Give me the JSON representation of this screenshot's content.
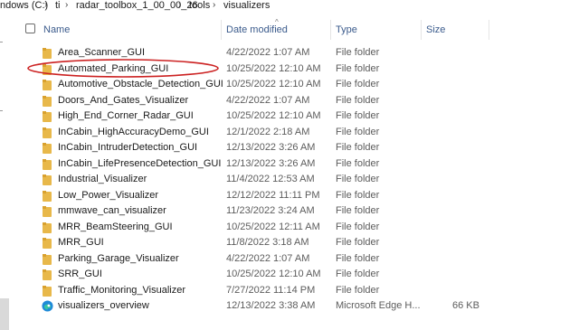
{
  "breadcrumb": {
    "segments": [
      "ndows (C:)",
      "ti",
      "radar_toolbox_1_00_00_26",
      "tools",
      "visualizers"
    ],
    "separator": "›"
  },
  "columns": {
    "name": "Name",
    "date": "Date modified",
    "type": "Type",
    "size": "Size"
  },
  "files": [
    {
      "name": "Area_Scanner_GUI",
      "date": "4/22/2022 1:07 AM",
      "type": "File folder",
      "size": "",
      "icon": "folder-icon"
    },
    {
      "name": "Automated_Parking_GUI",
      "date": "10/25/2022 12:10 AM",
      "type": "File folder",
      "size": "",
      "icon": "folder-icon"
    },
    {
      "name": "Automotive_Obstacle_Detection_GUI",
      "date": "10/25/2022 12:10 AM",
      "type": "File folder",
      "size": "",
      "icon": "folder-icon"
    },
    {
      "name": "Doors_And_Gates_Visualizer",
      "date": "4/22/2022 1:07 AM",
      "type": "File folder",
      "size": "",
      "icon": "folder-icon"
    },
    {
      "name": "High_End_Corner_Radar_GUI",
      "date": "10/25/2022 12:10 AM",
      "type": "File folder",
      "size": "",
      "icon": "folder-icon"
    },
    {
      "name": "InCabin_HighAccuracyDemo_GUI",
      "date": "12/1/2022 2:18 AM",
      "type": "File folder",
      "size": "",
      "icon": "folder-icon"
    },
    {
      "name": "InCabin_IntruderDetection_GUI",
      "date": "12/13/2022 3:26 AM",
      "type": "File folder",
      "size": "",
      "icon": "folder-icon"
    },
    {
      "name": "InCabin_LifePresenceDetection_GUI",
      "date": "12/13/2022 3:26 AM",
      "type": "File folder",
      "size": "",
      "icon": "folder-icon"
    },
    {
      "name": "Industrial_Visualizer",
      "date": "11/4/2022 12:53 AM",
      "type": "File folder",
      "size": "",
      "icon": "folder-icon"
    },
    {
      "name": "Low_Power_Visualizer",
      "date": "12/12/2022 11:11 PM",
      "type": "File folder",
      "size": "",
      "icon": "folder-icon"
    },
    {
      "name": "mmwave_can_visualizer",
      "date": "11/23/2022 3:24 AM",
      "type": "File folder",
      "size": "",
      "icon": "folder-icon"
    },
    {
      "name": "MRR_BeamSteering_GUI",
      "date": "10/25/2022 12:11 AM",
      "type": "File folder",
      "size": "",
      "icon": "folder-icon"
    },
    {
      "name": "MRR_GUI",
      "date": "11/8/2022 3:18 AM",
      "type": "File folder",
      "size": "",
      "icon": "folder-icon"
    },
    {
      "name": "Parking_Garage_Visualizer",
      "date": "4/22/2022 1:07 AM",
      "type": "File folder",
      "size": "",
      "icon": "folder-icon"
    },
    {
      "name": "SRR_GUI",
      "date": "10/25/2022 12:10 AM",
      "type": "File folder",
      "size": "",
      "icon": "folder-icon"
    },
    {
      "name": "Traffic_Monitoring_Visualizer",
      "date": "7/27/2022 11:14 PM",
      "type": "File folder",
      "size": "",
      "icon": "folder-icon"
    },
    {
      "name": "visualizers_overview",
      "date": "12/13/2022 3:38 AM",
      "type": "Microsoft Edge H...",
      "size": "66 KB",
      "icon": "edge-icon"
    }
  ],
  "annotation": {
    "target": "Automated_Parking_GUI",
    "shape": "ellipse",
    "color": "#cc2222"
  },
  "colors": {
    "folder": "#e8b84a",
    "folder_tab": "#d9a12f",
    "header_text": "#3b5b8c",
    "annotation": "#cc2222"
  }
}
